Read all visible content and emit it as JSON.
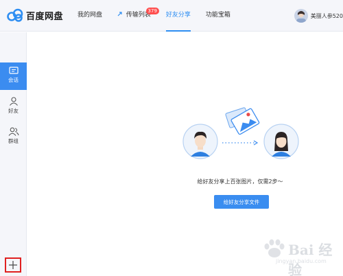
{
  "app": {
    "logo_text": "百度网盘"
  },
  "nav": {
    "items": [
      {
        "label": "我的网盘"
      },
      {
        "label": "传输列表",
        "badge": "379"
      },
      {
        "label": "好友分享"
      },
      {
        "label": "功能宝箱"
      }
    ],
    "active_index": 2
  },
  "user": {
    "name": "美丽人参520"
  },
  "sidebar": {
    "items": [
      {
        "label": "会话",
        "icon": "chat-icon",
        "active": true
      },
      {
        "label": "好友",
        "icon": "friend-icon",
        "active": false
      },
      {
        "label": "群组",
        "icon": "group-icon",
        "active": false
      }
    ],
    "add_icon": "plus-icon"
  },
  "main": {
    "hint": "给好友分享上百张图片，仅需2步～",
    "share_button": "给好友分享文件"
  },
  "watermark": {
    "text": "Bai 经验",
    "url": "jingyan.baidu.com"
  },
  "colors": {
    "accent": "#2e8ef2",
    "badge": "#ff4e4e",
    "sidebar_active": "#3b8cf0",
    "highlight_box": "#e02020"
  }
}
